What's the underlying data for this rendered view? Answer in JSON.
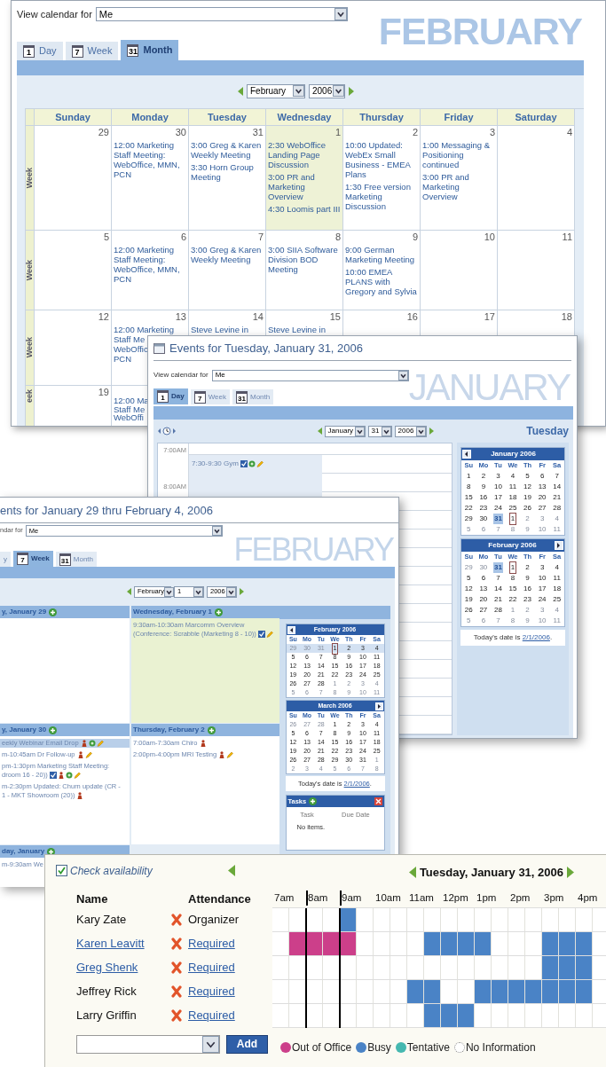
{
  "month_view": {
    "view_for_label": "View calendar for",
    "view_for_value": "Me",
    "banner": "FEBRUARY",
    "tabs": [
      {
        "label": "Day",
        "icon": "1",
        "selected": false
      },
      {
        "label": "Week",
        "icon": "7",
        "selected": false
      },
      {
        "label": "Month",
        "icon": "31",
        "selected": true
      }
    ],
    "nav": {
      "month": "February",
      "year": "2006"
    },
    "columns": [
      "Sunday",
      "Monday",
      "Tuesday",
      "Wednesday",
      "Thursday",
      "Friday",
      "Saturday"
    ],
    "weeks": [
      {
        "label": "Week",
        "days": [
          {
            "date": "29",
            "today": false
          },
          {
            "date": "30",
            "today": false,
            "events": [
              "12:00 Marketing Staff Meeting: WebOffice, MMN, PCN"
            ]
          },
          {
            "date": "31",
            "today": false,
            "events": [
              "3:00 Greg & Karen Weekly Meeting",
              "3:30 Horn Group Meeting"
            ]
          },
          {
            "date": "1",
            "today": true,
            "events": [
              "2:30 WebOffice Landing Page Discussion",
              "3:00 PR and Marketing Overview",
              "4:30 Loomis part III"
            ]
          },
          {
            "date": "2",
            "today": false,
            "events": [
              "10:00 Updated: WebEx Small Business - EMEA Plans",
              "1:30 Free version Marketing Discussion"
            ]
          },
          {
            "date": "3",
            "today": false,
            "events": [
              "1:00 Messaging & Positioning continued",
              "3:00 PR and Marketing Overview"
            ]
          },
          {
            "date": "4",
            "today": false
          }
        ]
      },
      {
        "label": "Week",
        "days": [
          {
            "date": "5",
            "today": false
          },
          {
            "date": "6",
            "today": false,
            "events": [
              "12:00 Marketing Staff Meeting: WebOffice, MMN, PCN"
            ]
          },
          {
            "date": "7",
            "today": false,
            "events": [
              "3:00 Greg & Karen Weekly Meeting"
            ]
          },
          {
            "date": "8",
            "today": false,
            "events": [
              "3:00 SIIA Software Division BOD Meeting"
            ]
          },
          {
            "date": "9",
            "today": false,
            "events": [
              "9:00 German Marketing Meeting",
              "10:00 EMEA PLANS with Gregory and Sylvia"
            ]
          },
          {
            "date": "10",
            "today": false
          },
          {
            "date": "11",
            "today": false
          }
        ]
      },
      {
        "label": "Week",
        "days": [
          {
            "date": "12",
            "today": false
          },
          {
            "date": "13",
            "today": false,
            "events": [
              "12:00 Marketing\nStaff Me\nWebOffic\nPCN"
            ]
          },
          {
            "date": "14",
            "today": false,
            "events": [
              "Steve Levine in"
            ]
          },
          {
            "date": "15",
            "today": false,
            "events": [
              "Steve Levine in"
            ]
          },
          {
            "date": "16",
            "today": false
          },
          {
            "date": "17",
            "today": false
          },
          {
            "date": "18",
            "today": false
          }
        ]
      },
      {
        "label": "eek",
        "days": [
          {
            "date": "19",
            "today": false
          },
          {
            "today": false,
            "events": [
              "12:00 Ma\nStaff Me\nWebOffi"
            ]
          }
        ]
      }
    ]
  },
  "day_view": {
    "title": "Events for Tuesday, January 31, 2006",
    "view_for_label": "View calendar for",
    "view_for_value": "Me",
    "banner": "JANUARY",
    "tabs": [
      {
        "label": "Day",
        "icon": "1",
        "selected": true
      },
      {
        "label": "Week",
        "icon": "7",
        "selected": false
      },
      {
        "label": "Month",
        "icon": "31",
        "selected": false
      }
    ],
    "nav": {
      "month": "January",
      "day": "31",
      "year": "2006"
    },
    "weekday": "Tuesday",
    "times": [
      "7:00AM",
      "8:00AM"
    ],
    "event": {
      "text": "7:30-9:30 Gym",
      "icons": [
        {
          "kind": "check"
        },
        {
          "kind": "circle"
        },
        {
          "kind": "pen"
        }
      ]
    },
    "calendars": [
      {
        "title": "January 2006",
        "prev": true,
        "next": false,
        "weekdays": [
          "Su",
          "Mo",
          "Tu",
          "We",
          "Th",
          "Fr",
          "Sa"
        ],
        "weeks": [
          {
            "days": [
              {
                "day": "1",
                "kind": "normal"
              },
              {
                "day": "2",
                "kind": "normal"
              },
              {
                "day": "3",
                "kind": "normal"
              },
              {
                "day": "4",
                "kind": "normal"
              },
              {
                "day": "5",
                "kind": "normal"
              },
              {
                "day": "6",
                "kind": "normal"
              },
              {
                "day": "7",
                "kind": "normal"
              }
            ]
          },
          {
            "days": [
              {
                "day": "8",
                "kind": "normal"
              },
              {
                "day": "9",
                "kind": "normal"
              },
              {
                "day": "10",
                "kind": "normal"
              },
              {
                "day": "11",
                "kind": "normal"
              },
              {
                "day": "12",
                "kind": "normal"
              },
              {
                "day": "13",
                "kind": "normal"
              },
              {
                "day": "14",
                "kind": "normal"
              }
            ]
          },
          {
            "days": [
              {
                "day": "15",
                "kind": "normal"
              },
              {
                "day": "16",
                "kind": "normal"
              },
              {
                "day": "17",
                "kind": "normal"
              },
              {
                "day": "18",
                "kind": "normal"
              },
              {
                "day": "19",
                "kind": "normal"
              },
              {
                "day": "20",
                "kind": "normal"
              },
              {
                "day": "21",
                "kind": "normal"
              }
            ]
          },
          {
            "days": [
              {
                "day": "22",
                "kind": "normal"
              },
              {
                "day": "23",
                "kind": "normal"
              },
              {
                "day": "24",
                "kind": "normal"
              },
              {
                "day": "25",
                "kind": "normal"
              },
              {
                "day": "26",
                "kind": "normal"
              },
              {
                "day": "27",
                "kind": "normal"
              },
              {
                "day": "28",
                "kind": "normal"
              }
            ]
          },
          {
            "days": [
              {
                "day": "29",
                "kind": "normal"
              },
              {
                "day": "30",
                "kind": "normal"
              },
              {
                "day": "31",
                "kind": "selected"
              },
              {
                "day": "1",
                "kind": "today"
              },
              {
                "day": "2",
                "kind": "muted"
              },
              {
                "day": "3",
                "kind": "muted"
              },
              {
                "day": "4",
                "kind": "muted"
              }
            ]
          },
          {
            "days": [
              {
                "day": "5",
                "kind": "muted"
              },
              {
                "day": "6",
                "kind": "muted"
              },
              {
                "day": "7",
                "kind": "muted"
              },
              {
                "day": "8",
                "kind": "muted"
              },
              {
                "day": "9",
                "kind": "muted"
              },
              {
                "day": "10",
                "kind": "muted"
              },
              {
                "day": "11",
                "kind": "muted"
              }
            ]
          }
        ]
      },
      {
        "title": "February 2006",
        "prev": false,
        "next": true,
        "weekdays": [
          "Su",
          "Mo",
          "Tu",
          "We",
          "Th",
          "Fr",
          "Sa"
        ],
        "weeks": [
          {
            "days": [
              {
                "day": "29",
                "kind": "muted"
              },
              {
                "day": "30",
                "kind": "muted"
              },
              {
                "day": "31",
                "kind": "selected"
              },
              {
                "day": "1",
                "kind": "today"
              },
              {
                "day": "2",
                "kind": "normal"
              },
              {
                "day": "3",
                "kind": "normal"
              },
              {
                "day": "4",
                "kind": "normal"
              }
            ]
          },
          {
            "days": [
              {
                "day": "5",
                "kind": "normal"
              },
              {
                "day": "6",
                "kind": "normal"
              },
              {
                "day": "7",
                "kind": "normal"
              },
              {
                "day": "8",
                "kind": "normal"
              },
              {
                "day": "9",
                "kind": "normal"
              },
              {
                "day": "10",
                "kind": "normal"
              },
              {
                "day": "11",
                "kind": "normal"
              }
            ]
          },
          {
            "days": [
              {
                "day": "12",
                "kind": "normal"
              },
              {
                "day": "13",
                "kind": "normal"
              },
              {
                "day": "14",
                "kind": "normal"
              },
              {
                "day": "15",
                "kind": "normal"
              },
              {
                "day": "16",
                "kind": "normal"
              },
              {
                "day": "17",
                "kind": "normal"
              },
              {
                "day": "18",
                "kind": "normal"
              }
            ]
          },
          {
            "days": [
              {
                "day": "19",
                "kind": "normal"
              },
              {
                "day": "20",
                "kind": "normal"
              },
              {
                "day": "21",
                "kind": "normal"
              },
              {
                "day": "22",
                "kind": "normal"
              },
              {
                "day": "23",
                "kind": "normal"
              },
              {
                "day": "24",
                "kind": "normal"
              },
              {
                "day": "25",
                "kind": "normal"
              }
            ]
          },
          {
            "days": [
              {
                "day": "26",
                "kind": "normal"
              },
              {
                "day": "27",
                "kind": "normal"
              },
              {
                "day": "28",
                "kind": "normal"
              },
              {
                "day": "1",
                "kind": "muted"
              },
              {
                "day": "2",
                "kind": "muted"
              },
              {
                "day": "3",
                "kind": "muted"
              },
              {
                "day": "4",
                "kind": "muted"
              }
            ]
          },
          {
            "days": [
              {
                "day": "5",
                "kind": "muted"
              },
              {
                "day": "6",
                "kind": "muted"
              },
              {
                "day": "7",
                "kind": "muted"
              },
              {
                "day": "8",
                "kind": "muted"
              },
              {
                "day": "9",
                "kind": "muted"
              },
              {
                "day": "10",
                "kind": "muted"
              },
              {
                "day": "11",
                "kind": "muted"
              }
            ]
          }
        ]
      }
    ],
    "today_text": "Today's date is",
    "today_link": "2/1/2006",
    "today_end": "."
  },
  "week_view": {
    "title": "ents for January 29 thru February 4, 2006",
    "view_for_label": "ndar for",
    "view_for_value": "Me",
    "banner": "FEBRUARY",
    "tabs": [
      {
        "label": "y",
        "selected": false
      },
      {
        "label": "Week",
        "icon": "7",
        "selected": true
      },
      {
        "label": "Month",
        "icon": "31",
        "selected": false
      }
    ],
    "nav": {
      "month": "February",
      "day": "1",
      "year": "2006"
    },
    "rows": [
      [
        {
          "heading": "y, January 29",
          "today": false
        },
        {
          "heading": "Wednesday, February 1",
          "today": true,
          "events": [
            {
              "text": "9:30am-10:30am Marcomm Overview (Conference: Scrabble (Marketing 8 - 10))",
              "icons": [
                {
                  "kind": "check"
                },
                {
                  "kind": "pen"
                }
              ],
              "highlighted": false
            }
          ]
        }
      ],
      [
        {
          "heading": "y, January 30",
          "today": false,
          "events": [
            {
              "text": "eekly Webinar Email Drop",
              "icons": [
                {
                  "kind": "figure"
                },
                {
                  "kind": "circle"
                },
                {
                  "kind": "pen"
                }
              ],
              "highlighted": true
            },
            {
              "text": "m-10:45am Dr Follow-up",
              "icons": [
                {
                  "kind": "figure"
                },
                {
                  "kind": "pen"
                }
              ],
              "highlighted": false
            },
            {
              "text": "pm-1:30pm Marketing Staff Meeting:\ndroom 16 - 20))",
              "icons": [
                {
                  "kind": "check"
                },
                {
                  "kind": "figure"
                },
                {
                  "kind": "circle"
                },
                {
                  "kind": "pen"
                }
              ],
              "highlighted": false
            },
            {
              "text": "m-2:30pm Updated: Churn update (CR -\n1 - MKT Showroom (20))",
              "icons": [
                {
                  "kind": "figure"
                }
              ],
              "highlighted": false
            }
          ]
        },
        {
          "heading": "Thursday, February 2",
          "today": false,
          "events": [
            {
              "text": "7:00am-7:30am Chiro",
              "icons": [
                {
                  "kind": "figure"
                }
              ],
              "highlighted": false
            },
            {
              "text": "2:00pm-4:00pm MRI Testing",
              "icons": [
                {
                  "kind": "figure"
                },
                {
                  "kind": "pen"
                }
              ],
              "highlighted": false
            }
          ]
        }
      ],
      [
        {
          "heading": "day, January",
          "today": false,
          "events": [
            {
              "text": "m-9:30am We",
              "highlighted": false
            }
          ]
        }
      ]
    ],
    "calendars": [
      {
        "title": "February 2006",
        "prev": true,
        "next": false,
        "weekdays": [
          "Su",
          "Mo",
          "Tu",
          "We",
          "Th",
          "Fr",
          "Sa"
        ],
        "weeks": [
          {
            "selected": true,
            "days": [
              {
                "day": "29",
                "kind": "muted"
              },
              {
                "day": "30",
                "kind": "muted"
              },
              {
                "day": "31",
                "kind": "muted"
              },
              {
                "day": "1",
                "kind": "today"
              },
              {
                "day": "2",
                "kind": "normal"
              },
              {
                "day": "3",
                "kind": "normal"
              },
              {
                "day": "4",
                "kind": "normal"
              }
            ]
          },
          {
            "selected": false,
            "days": [
              {
                "day": "5",
                "kind": "normal"
              },
              {
                "day": "6",
                "kind": "normal"
              },
              {
                "day": "7",
                "kind": "normal"
              },
              {
                "day": "8",
                "kind": "normal"
              },
              {
                "day": "9",
                "kind": "normal"
              },
              {
                "day": "10",
                "kind": "normal"
              },
              {
                "day": "11",
                "kind": "normal"
              }
            ]
          },
          {
            "selected": false,
            "days": [
              {
                "day": "12",
                "kind": "normal"
              },
              {
                "day": "13",
                "kind": "normal"
              },
              {
                "day": "14",
                "kind": "normal"
              },
              {
                "day": "15",
                "kind": "normal"
              },
              {
                "day": "16",
                "kind": "normal"
              },
              {
                "day": "17",
                "kind": "normal"
              },
              {
                "day": "18",
                "kind": "normal"
              }
            ]
          },
          {
            "selected": false,
            "days": [
              {
                "day": "19",
                "kind": "normal"
              },
              {
                "day": "20",
                "kind": "normal"
              },
              {
                "day": "21",
                "kind": "normal"
              },
              {
                "day": "22",
                "kind": "normal"
              },
              {
                "day": "23",
                "kind": "normal"
              },
              {
                "day": "24",
                "kind": "normal"
              },
              {
                "day": "25",
                "kind": "normal"
              }
            ]
          },
          {
            "selected": false,
            "days": [
              {
                "day": "26",
                "kind": "normal"
              },
              {
                "day": "27",
                "kind": "normal"
              },
              {
                "day": "28",
                "kind": "normal"
              },
              {
                "day": "1",
                "kind": "muted"
              },
              {
                "day": "2",
                "kind": "muted"
              },
              {
                "day": "3",
                "kind": "muted"
              },
              {
                "day": "4",
                "kind": "muted"
              }
            ]
          },
          {
            "selected": false,
            "days": [
              {
                "day": "5",
                "kind": "muted"
              },
              {
                "day": "6",
                "kind": "muted"
              },
              {
                "day": "7",
                "kind": "muted"
              },
              {
                "day": "8",
                "kind": "muted"
              },
              {
                "day": "9",
                "kind": "muted"
              },
              {
                "day": "10",
                "kind": "muted"
              },
              {
                "day": "11",
                "kind": "muted"
              }
            ]
          }
        ]
      },
      {
        "title": "March 2006",
        "prev": false,
        "next": true,
        "weekdays": [
          "Su",
          "Mo",
          "Tu",
          "We",
          "Th",
          "Fr",
          "Sa"
        ],
        "weeks": [
          {
            "days": [
              {
                "day": "26",
                "kind": "muted"
              },
              {
                "day": "27",
                "kind": "muted"
              },
              {
                "day": "28",
                "kind": "muted"
              },
              {
                "day": "1",
                "kind": "normal"
              },
              {
                "day": "2",
                "kind": "normal"
              },
              {
                "day": "3",
                "kind": "normal"
              },
              {
                "day": "4",
                "kind": "normal"
              }
            ]
          },
          {
            "days": [
              {
                "day": "5",
                "kind": "normal"
              },
              {
                "day": "6",
                "kind": "normal"
              },
              {
                "day": "7",
                "kind": "normal"
              },
              {
                "day": "8",
                "kind": "normal"
              },
              {
                "day": "9",
                "kind": "normal"
              },
              {
                "day": "10",
                "kind": "normal"
              },
              {
                "day": "11",
                "kind": "normal"
              }
            ]
          },
          {
            "days": [
              {
                "day": "12",
                "kind": "normal"
              },
              {
                "day": "13",
                "kind": "normal"
              },
              {
                "day": "14",
                "kind": "normal"
              },
              {
                "day": "15",
                "kind": "normal"
              },
              {
                "day": "16",
                "kind": "normal"
              },
              {
                "day": "17",
                "kind": "normal"
              },
              {
                "day": "18",
                "kind": "normal"
              }
            ]
          },
          {
            "days": [
              {
                "day": "19",
                "kind": "normal"
              },
              {
                "day": "20",
                "kind": "normal"
              },
              {
                "day": "21",
                "kind": "normal"
              },
              {
                "day": "22",
                "kind": "normal"
              },
              {
                "day": "23",
                "kind": "normal"
              },
              {
                "day": "24",
                "kind": "normal"
              },
              {
                "day": "25",
                "kind": "normal"
              }
            ]
          },
          {
            "days": [
              {
                "day": "26",
                "kind": "normal"
              },
              {
                "day": "27",
                "kind": "normal"
              },
              {
                "day": "28",
                "kind": "normal"
              },
              {
                "day": "29",
                "kind": "normal"
              },
              {
                "day": "30",
                "kind": "normal"
              },
              {
                "day": "31",
                "kind": "normal"
              },
              {
                "day": "1",
                "kind": "muted"
              }
            ]
          },
          {
            "days": [
              {
                "day": "2",
                "kind": "muted"
              },
              {
                "day": "3",
                "kind": "muted"
              },
              {
                "day": "4",
                "kind": "muted"
              },
              {
                "day": "5",
                "kind": "muted"
              },
              {
                "day": "6",
                "kind": "muted"
              },
              {
                "day": "7",
                "kind": "muted"
              },
              {
                "day": "8",
                "kind": "muted"
              }
            ]
          }
        ]
      }
    ],
    "today_text": "Today's date is",
    "today_link": "2/1/2006",
    "today_end": ".",
    "tasks": {
      "title": "Tasks",
      "columns": [
        "Task",
        "Due Date"
      ],
      "empty": "No items."
    }
  },
  "availability": {
    "check": {
      "label": "Check availability",
      "checked": true
    },
    "date": "Tuesday, January 31, 2006",
    "columns": [
      "Name",
      "Attendance"
    ],
    "hours": [
      {
        "label": "7am",
        "marked": false
      },
      {
        "label": "8am",
        "marked": true
      },
      {
        "label": "9am",
        "marked": true
      },
      {
        "label": "10am",
        "marked": false
      },
      {
        "label": "11am",
        "marked": false
      },
      {
        "label": "12pm",
        "marked": false
      },
      {
        "label": "1pm",
        "marked": false
      },
      {
        "label": "2pm",
        "marked": false
      },
      {
        "label": "3pm",
        "marked": false
      },
      {
        "label": "4pm",
        "marked": false
      }
    ],
    "attendees": [
      {
        "name": "Kary Zate",
        "link": false,
        "attendance": "Organizer",
        "attendance_link": false,
        "slots": [
          {
            "kind": "free"
          },
          {
            "kind": "free"
          },
          {
            "kind": "free"
          },
          {
            "kind": "free"
          },
          {
            "kind": "busy"
          },
          {
            "kind": "free"
          },
          {
            "kind": "free"
          },
          {
            "kind": "free"
          },
          {
            "kind": "free"
          },
          {
            "kind": "free"
          },
          {
            "kind": "free"
          },
          {
            "kind": "free"
          },
          {
            "kind": "free"
          },
          {
            "kind": "free"
          },
          {
            "kind": "free"
          },
          {
            "kind": "free"
          },
          {
            "kind": "free"
          },
          {
            "kind": "free"
          },
          {
            "kind": "free"
          },
          {
            "kind": "free"
          }
        ]
      },
      {
        "name": "Karen Leavitt",
        "link": true,
        "attendance": "Required",
        "attendance_link": true,
        "slots": [
          {
            "kind": "free"
          },
          {
            "kind": "out"
          },
          {
            "kind": "out"
          },
          {
            "kind": "out"
          },
          {
            "kind": "out"
          },
          {
            "kind": "free"
          },
          {
            "kind": "free"
          },
          {
            "kind": "free"
          },
          {
            "kind": "free"
          },
          {
            "kind": "busy"
          },
          {
            "kind": "busy"
          },
          {
            "kind": "busy"
          },
          {
            "kind": "busy"
          },
          {
            "kind": "free"
          },
          {
            "kind": "free"
          },
          {
            "kind": "free"
          },
          {
            "kind": "busy"
          },
          {
            "kind": "busy"
          },
          {
            "kind": "busy"
          },
          {
            "kind": "free"
          }
        ]
      },
      {
        "name": "Greg Shenk",
        "link": true,
        "attendance": "Required",
        "attendance_link": true,
        "slots": [
          {
            "kind": "free"
          },
          {
            "kind": "free"
          },
          {
            "kind": "free"
          },
          {
            "kind": "free"
          },
          {
            "kind": "free"
          },
          {
            "kind": "free"
          },
          {
            "kind": "free"
          },
          {
            "kind": "free"
          },
          {
            "kind": "free"
          },
          {
            "kind": "free"
          },
          {
            "kind": "free"
          },
          {
            "kind": "free"
          },
          {
            "kind": "free"
          },
          {
            "kind": "free"
          },
          {
            "kind": "free"
          },
          {
            "kind": "free"
          },
          {
            "kind": "busy"
          },
          {
            "kind": "busy"
          },
          {
            "kind": "busy"
          },
          {
            "kind": "free"
          }
        ]
      },
      {
        "name": "Jeffrey Rick",
        "link": false,
        "attendance": "Required",
        "attendance_link": true,
        "slots": [
          {
            "kind": "free"
          },
          {
            "kind": "free"
          },
          {
            "kind": "free"
          },
          {
            "kind": "free"
          },
          {
            "kind": "free"
          },
          {
            "kind": "free"
          },
          {
            "kind": "free"
          },
          {
            "kind": "free"
          },
          {
            "kind": "busy"
          },
          {
            "kind": "busy"
          },
          {
            "kind": "free"
          },
          {
            "kind": "free"
          },
          {
            "kind": "busy"
          },
          {
            "kind": "busy"
          },
          {
            "kind": "busy"
          },
          {
            "kind": "busy"
          },
          {
            "kind": "busy"
          },
          {
            "kind": "busy"
          },
          {
            "kind": "busy"
          },
          {
            "kind": "free"
          }
        ]
      },
      {
        "name": "Larry Griffin",
        "link": false,
        "attendance": "Required",
        "attendance_link": true,
        "slots": [
          {
            "kind": "free"
          },
          {
            "kind": "free"
          },
          {
            "kind": "free"
          },
          {
            "kind": "free"
          },
          {
            "kind": "free"
          },
          {
            "kind": "free"
          },
          {
            "kind": "free"
          },
          {
            "kind": "free"
          },
          {
            "kind": "free"
          },
          {
            "kind": "busy"
          },
          {
            "kind": "busy"
          },
          {
            "kind": "busy"
          },
          {
            "kind": "free"
          },
          {
            "kind": "free"
          },
          {
            "kind": "free"
          },
          {
            "kind": "free"
          },
          {
            "kind": "free"
          },
          {
            "kind": "free"
          },
          {
            "kind": "free"
          },
          {
            "kind": "free"
          }
        ]
      }
    ],
    "add_button": "Add",
    "legend": [
      {
        "label": "Out of Office",
        "kind": "out"
      },
      {
        "label": "Busy",
        "kind": "busy"
      },
      {
        "label": "Tentative",
        "kind": "tentative"
      },
      {
        "label": "No Information",
        "kind": "none"
      }
    ]
  }
}
